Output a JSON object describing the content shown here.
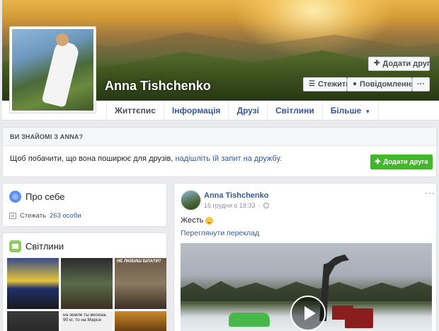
{
  "profile": {
    "name": "Anna Tishchenko"
  },
  "cover_actions": {
    "add_friend": "Додати друга",
    "follow": "Стежити",
    "message": "Повідомлення",
    "more": "···"
  },
  "nav": {
    "tabs": [
      {
        "label": "Життєпис"
      },
      {
        "label": "Інформація"
      },
      {
        "label": "Друзі"
      },
      {
        "label": "Світлини"
      },
      {
        "label": "Більше"
      }
    ]
  },
  "know": {
    "heading": "ВИ ЗНАЙОМІ З ANNA?",
    "text_prefix": "Щоб побачити, що вона поширює для друзів, ",
    "link": "надішліть їй запит на дружбу.",
    "button": "Додати друга"
  },
  "about": {
    "title": "Про себе",
    "follow_prefix": "Стежать",
    "follow_count": "263 особи"
  },
  "photos": {
    "title": "Світлини",
    "captions": [
      "НЕ ЛЮБИШ БІЛАТИ?",
      "на земле ты весишь 90 кг, то на Марсе"
    ]
  },
  "post": {
    "author": "Anna Tishchenko",
    "date": "16 грудня о 18:33",
    "separator": "·",
    "more": "···",
    "text": "Жесть",
    "translate": "Переглянути переклад"
  },
  "icons": {
    "accent": "#365899",
    "green": "#42b72a"
  }
}
